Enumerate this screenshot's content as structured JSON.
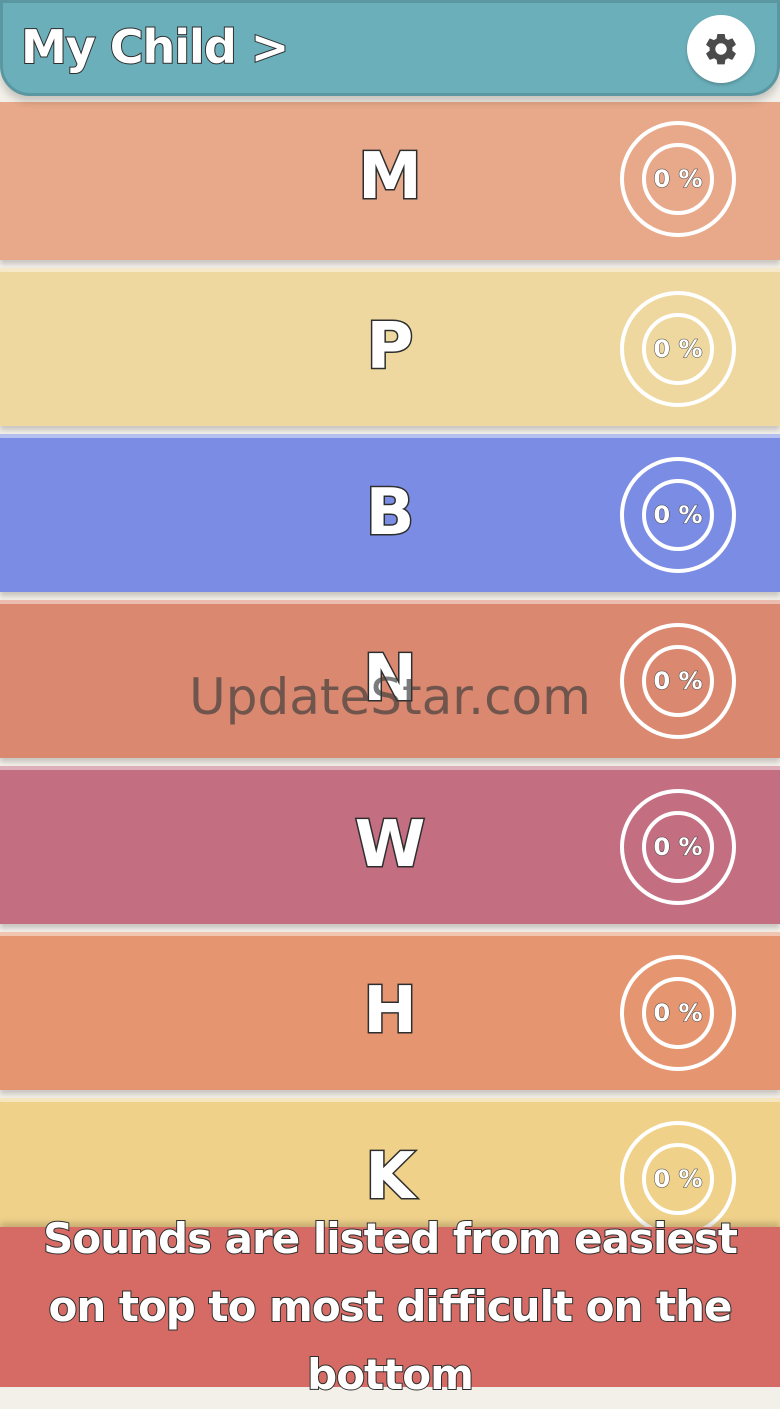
{
  "header": {
    "title": "My Child >",
    "settings_icon": "gear-icon"
  },
  "rows": [
    {
      "letter": "M",
      "progress": "0 %",
      "progress_value": 0,
      "color": "#e8a98a"
    },
    {
      "letter": "P",
      "progress": "0 %",
      "progress_value": 0,
      "color": "#efd89f"
    },
    {
      "letter": "B",
      "progress": "0 %",
      "progress_value": 0,
      "color": "#7b8ce4"
    },
    {
      "letter": "N",
      "progress": "0 %",
      "progress_value": 0,
      "color": "#db8870"
    },
    {
      "letter": "W",
      "progress": "0 %",
      "progress_value": 0,
      "color": "#c46e82"
    },
    {
      "letter": "H",
      "progress": "0 %",
      "progress_value": 0,
      "color": "#e59670"
    },
    {
      "letter": "K",
      "progress": "0 %",
      "progress_value": 0,
      "color": "#efd18a"
    }
  ],
  "footer": {
    "text": "Sounds are listed from easiest on top to most difficult on the bottom",
    "color": "#d56b64"
  },
  "watermark": "UpdateStar.com"
}
